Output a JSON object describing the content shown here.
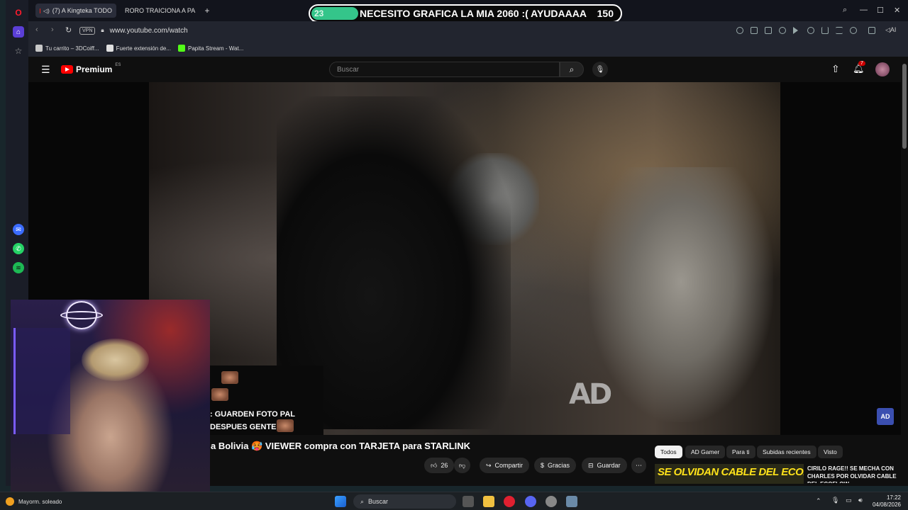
{
  "browser": {
    "tabs": [
      {
        "label": "(7) A Kingteka TODO",
        "active": true
      },
      {
        "label": "RORO TRAICIONA A PABL",
        "active": false
      }
    ],
    "new_tab": "+",
    "vpn": "VPN",
    "url": "www.youtube.com/watch",
    "ai_label": "AI",
    "bookmarks": [
      "Tu carrito – 3DCoiff...",
      "Fuerte extensión de...",
      "Papita Stream - Wat..."
    ]
  },
  "stream_goal": {
    "current": "23",
    "target": "150",
    "progress": 0.153,
    "title": "NECESITO GRAFICA LA MIA 2060 :( AYUDAAAA",
    "fill_color": "#34c58a"
  },
  "youtube": {
    "brand": "Premium",
    "region": "ES",
    "search_placeholder": "Buscar",
    "notification_count": "7",
    "watermark": "AD",
    "channel_badge": "AD"
  },
  "chat": {
    "lines": [
      ": GUARDEN FOTO PAL",
      "DESPUES GENTE"
    ]
  },
  "video": {
    "title": "a Bolivia 🥵 VIEWER compra con TARJETA para STARLINK",
    "likes": "26",
    "share_label": "Compartir",
    "thanks_label": "Gracias",
    "save_label": "Guardar",
    "more_label": "⋯"
  },
  "chips": [
    "Todos",
    "AD Gamer",
    "Para ti",
    "Subidas recientes",
    "Visto"
  ],
  "recommendation": {
    "thumbnail_text": "SE OLVIDAN CABLE DEL ECOFLOW",
    "title": "CIRILO RAGE!! SE MECHA CON CHARLES POR OLVIDAR CABLE DEL ECOFLOW"
  },
  "taskbar": {
    "weather": "Mayorm. soleado",
    "search_placeholder": "Buscar",
    "time": "17:22",
    "date": "04/08/2026"
  }
}
